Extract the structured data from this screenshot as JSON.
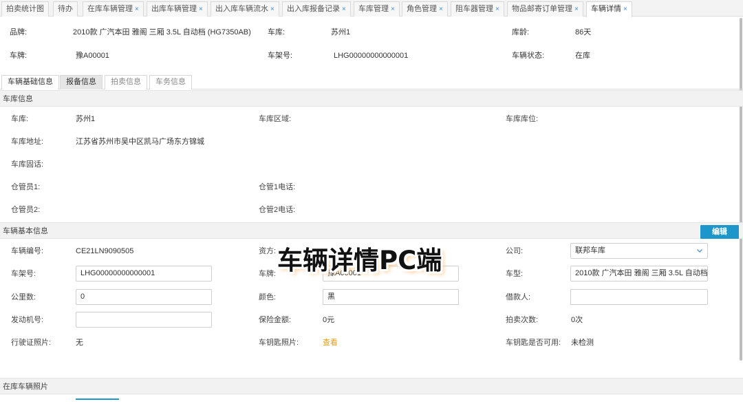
{
  "tabs": [
    {
      "label": "拍卖统计图",
      "closable": false
    },
    {
      "label": "待办",
      "closable": false
    },
    {
      "label": "在库车辆管理",
      "closable": true
    },
    {
      "label": "出库车辆管理",
      "closable": true
    },
    {
      "label": "出入库车辆流水",
      "closable": true
    },
    {
      "label": "出入库报备记录",
      "closable": true
    },
    {
      "label": "车库管理",
      "closable": true
    },
    {
      "label": "角色管理",
      "closable": true
    },
    {
      "label": "阻车器管理",
      "closable": true
    },
    {
      "label": "物品邮寄订单管理",
      "closable": true
    },
    {
      "label": "车辆详情",
      "closable": true,
      "active": true
    }
  ],
  "close_glyph": "×",
  "header": {
    "brand_label": "品牌:",
    "brand_value": "2010款 广汽本田 雅阁 三厢 3.5L 自动档 (HG7350AB)",
    "garage_label": "车库:",
    "garage_value": "苏州1",
    "age_label": "库龄:",
    "age_value": "86天",
    "plate_label": "车牌:",
    "plate_value": "豫A00001",
    "vin_label": "车架号:",
    "vin_value": "LHG00000000000001",
    "status_label": "车辆状态:",
    "status_value": "在库"
  },
  "subtabs": [
    "车辆基础信息",
    "报备信息",
    "拍卖信息",
    "车务信息"
  ],
  "garage_section": {
    "title": "车库信息",
    "garage_label": "车库:",
    "garage_value": "苏州1",
    "area_label": "车库区域:",
    "area_value": "",
    "slot_label": "车库库位:",
    "slot_value": "",
    "address_label": "车库地址:",
    "address_value": "江苏省苏州市吴中区凯马广场东方锦城",
    "phone_label": "车库固话:",
    "keeper1_label": "仓管员1:",
    "keeper1_phone_label": "仓管1电话:",
    "keeper2_label": "仓管员2:",
    "keeper2_phone_label": "仓管2电话:"
  },
  "vehicle_section": {
    "title": "车辆基本信息",
    "edit_label": "编辑",
    "code_label": "车辆编号:",
    "code_value": "CE21LN9090505",
    "funder_label": "资方:",
    "company_label": "公司:",
    "company_value": "联邦车库",
    "vin_label": "车架号:",
    "vin_value": "LHG00000000000001",
    "plate_label": "车牌:",
    "plate_value": "豫A00001",
    "model_label": "车型:",
    "model_value": "2010款 广汽本田 雅阁 三厢 3.5L 自动档",
    "mileage_label": "公里数:",
    "mileage_value": "0",
    "color_label": "颜色:",
    "color_value": "黑",
    "borrower_label": "借款人:",
    "borrower_value": "",
    "engine_label": "发动机号:",
    "engine_value": "",
    "insurance_label": "保险金额:",
    "insurance_value": "0元",
    "auction_count_label": "拍卖次数:",
    "auction_count_value": "0次",
    "license_photo_label": "行驶证照片:",
    "license_photo_value": "无",
    "key_photo_label": "车钥匙照片:",
    "key_photo_link": "查看",
    "key_usable_label": "车钥匙是否可用:",
    "key_usable_value": "未检测"
  },
  "photo_section": {
    "title": "在库车辆照片"
  },
  "overlay_title": "车辆详情PC端",
  "colors": {
    "accent": "#1d96c9",
    "link": "#e49a1c",
    "close": "#3a8ee6"
  }
}
